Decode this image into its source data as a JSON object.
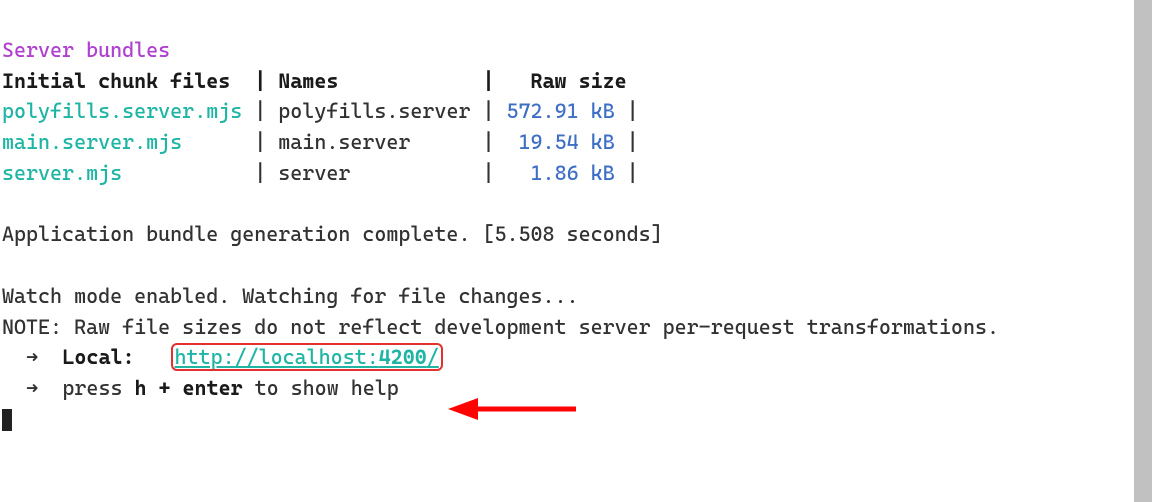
{
  "section_heading": "Server bundles",
  "table": {
    "headers": [
      "Initial chunk files",
      "Names",
      "Raw size"
    ],
    "rows": [
      {
        "file": "polyfills.server.mjs",
        "name": "polyfills.server",
        "size": "572.91 kB"
      },
      {
        "file": "main.server.mjs",
        "name": "main.server",
        "size": " 19.54 kB"
      },
      {
        "file": "server.mjs",
        "name": "server",
        "size": "  1.86 kB"
      }
    ]
  },
  "status": {
    "complete": "Application bundle generation complete. [5.508 seconds]",
    "watch": "Watch mode enabled. Watching for file changes...",
    "note": "NOTE: Raw file sizes do not reflect development server per-request transformations."
  },
  "serve": {
    "arrow": "➜",
    "local_label": "Local",
    "local_url_prefix": "http://localhost:",
    "local_url_port": "4200",
    "local_url_suffix": "/",
    "help_prefix": "press ",
    "help_key1": "h",
    "help_plus": " + ",
    "help_key2": "enter",
    "help_suffix": " to show help"
  },
  "annotation": {
    "arrow_color": "#ff0202"
  }
}
